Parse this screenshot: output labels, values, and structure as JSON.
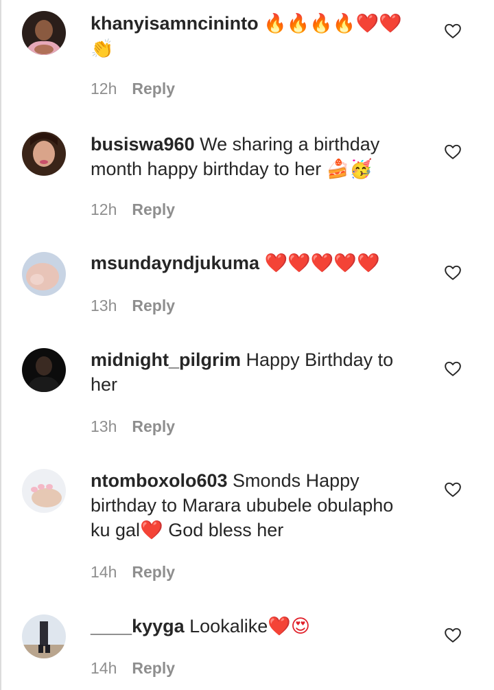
{
  "reply_label": "Reply",
  "colors": {
    "heart": "#e0202a",
    "meta": "#8e8e8e",
    "text": "#262626"
  },
  "comments": [
    {
      "username": "khanyisamncininto",
      "text": "",
      "emojis": "🔥🔥🔥🔥❤️❤️ 👏",
      "time": "12h"
    },
    {
      "username": "busiswa960",
      "text": "We sharing a birthday month happy birthday to her",
      "emojis": "🍰🥳",
      "time": "12h"
    },
    {
      "username": "msundayndjukuma",
      "text": "",
      "emojis": "❤️❤️❤️❤️❤️",
      "time": "13h"
    },
    {
      "username": "midnight_pilgrim",
      "text": "Happy Birthday to her",
      "emojis": "",
      "time": "13h"
    },
    {
      "username": "ntomboxolo603",
      "text": "Smonds Happy birthday to Marara ububele obulapho ku gal",
      "emojis": "❤️",
      "text_after": "God bless her",
      "time": "14h"
    },
    {
      "username": "____kyyga",
      "text": "Lookalike",
      "emojis": "❤️😍",
      "time": "14h"
    }
  ]
}
